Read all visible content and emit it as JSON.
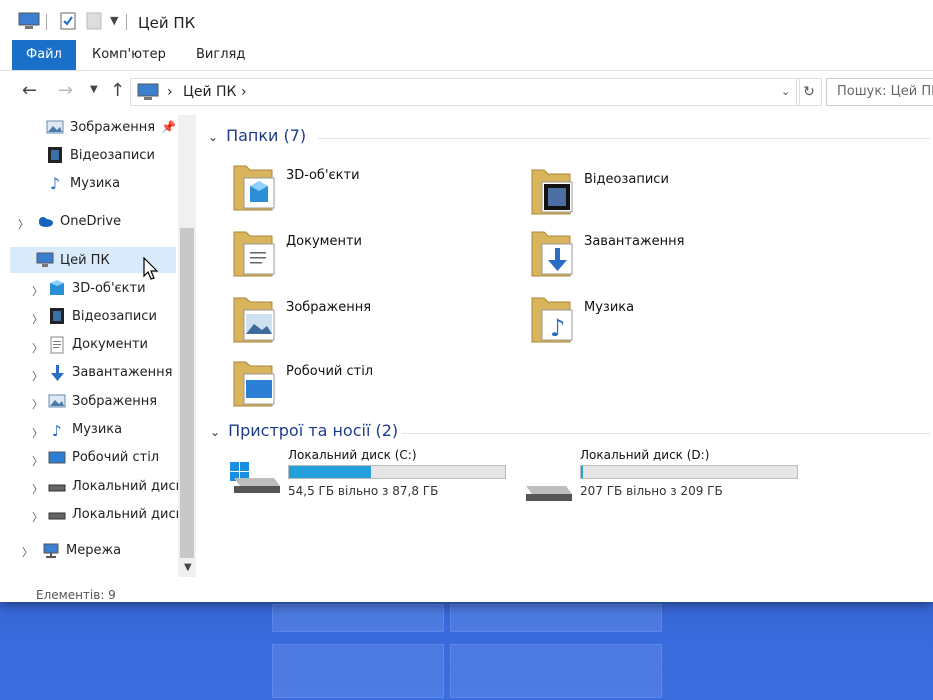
{
  "window": {
    "title": "Цей ПК"
  },
  "ribbon": {
    "tabs": [
      {
        "label": "Файл"
      },
      {
        "label": "Комп'ютер"
      },
      {
        "label": "Вигляд"
      }
    ]
  },
  "address": {
    "path": [
      "Цей ПК"
    ],
    "search_placeholder": "Пошук: Цей ПК"
  },
  "sidebar": {
    "quick": [
      {
        "label": "Зображення",
        "icon": "pictures-icon",
        "pinned": true
      },
      {
        "label": "Відеозаписи",
        "icon": "videos-icon"
      },
      {
        "label": "Музика",
        "icon": "music-icon"
      }
    ],
    "onedrive": {
      "label": "OneDrive"
    },
    "this_pc": {
      "label": "Цей ПК"
    },
    "children": [
      {
        "label": "3D-об'єкти",
        "icon": "3d-objects-icon"
      },
      {
        "label": "Відеозаписи",
        "icon": "videos-icon"
      },
      {
        "label": "Документи",
        "icon": "documents-icon"
      },
      {
        "label": "Завантаження",
        "icon": "downloads-icon"
      },
      {
        "label": "Зображення",
        "icon": "pictures-icon"
      },
      {
        "label": "Музика",
        "icon": "music-icon"
      },
      {
        "label": "Робочий стіл",
        "icon": "desktop-icon"
      },
      {
        "label": "Локальний диск",
        "icon": "drive-icon"
      },
      {
        "label": "Локальний диск",
        "icon": "drive-icon"
      }
    ],
    "network": {
      "label": "Мережа"
    }
  },
  "status": {
    "items": "Елементів: 9"
  },
  "folders_section": {
    "title": "Папки (7)"
  },
  "folders": [
    {
      "label": "3D-об'єкти",
      "icon": "3d-objects-icon"
    },
    {
      "label": "Відеозаписи",
      "icon": "videos-icon"
    },
    {
      "label": "Документи",
      "icon": "documents-icon"
    },
    {
      "label": "Завантаження",
      "icon": "downloads-icon"
    },
    {
      "label": "Зображення",
      "icon": "pictures-icon"
    },
    {
      "label": "Музика",
      "icon": "music-icon"
    },
    {
      "label": "Робочий стіл",
      "icon": "desktop-icon"
    }
  ],
  "devices_section": {
    "title": "Пристрої та носії (2)"
  },
  "drives": [
    {
      "name": "Локальний диск (C:)",
      "free": "54,5 ГБ вільно з 87,8 ГБ",
      "used_fraction": 0.38
    },
    {
      "name": "Локальний диск (D:)",
      "free": "207 ГБ вільно з 209 ГБ",
      "used_fraction": 0.01
    }
  ],
  "colors": {
    "accent": "#1a6fc9",
    "selection": "#d9ebfa",
    "bar_fill": "#26a0da",
    "desktop": "#2a57c4"
  }
}
